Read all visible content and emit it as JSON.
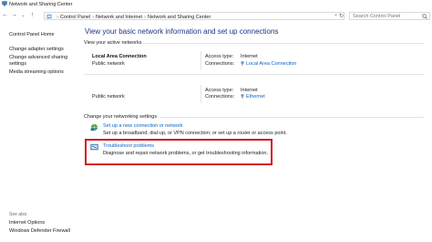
{
  "window": {
    "title": "Network and Sharing Center"
  },
  "address": {
    "crumbs": [
      "Control Panel",
      "Network and Internet",
      "Network and Sharing Center"
    ],
    "sep": "›"
  },
  "search": {
    "placeholder": "Search Control Panel"
  },
  "sidebar": {
    "links": [
      "Control Panel Home",
      "Change adapter settings",
      "Change advanced sharing",
      "settings",
      "Media streaming options"
    ],
    "see_also_label": "See also",
    "see_also": [
      "Internet Options",
      "Windows Defender Firewall"
    ]
  },
  "main": {
    "heading": "View your basic network information and set up connections",
    "active_label": "View your active networks",
    "networks": [
      {
        "name": "Local Area Connection",
        "type": "Public network",
        "access_label": "Access type:",
        "access_value": "Internet",
        "connections_label": "Connections:",
        "connection": "Local Area Connection"
      },
      {
        "name": "",
        "type": "Public network",
        "access_label": "Access type:",
        "access_value": "Internet",
        "connections_label": "Connections:",
        "connection": "Ethernet"
      }
    ],
    "settings_label": "Change your networking settings",
    "tasks": [
      {
        "link": "Set up a new connection or network",
        "desc": "Set up a broadband, dial-up, or VPN connection; or set up a router or access point."
      },
      {
        "link": "Troubleshoot problems",
        "desc": "Diagnose and repair network problems, or get troubleshooting information."
      }
    ]
  },
  "colors": {
    "link": "#0b62c6",
    "heading": "#1e3287",
    "highlight": "#d1151d"
  }
}
